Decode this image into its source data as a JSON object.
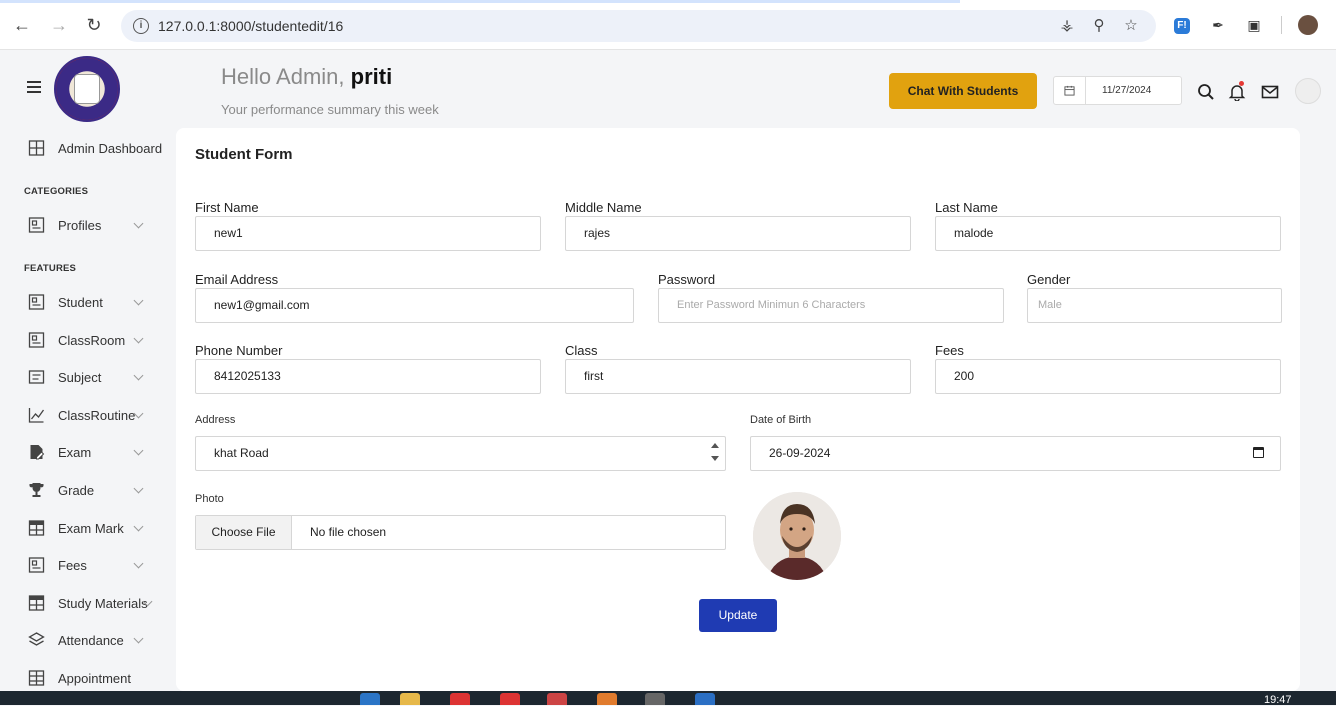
{
  "browser": {
    "url": "127.0.0.1:8000/studentedit/16",
    "ext_label": "F!"
  },
  "sidebar": {
    "dashboard": "Admin Dashboard",
    "categories_heading": "CATEGORIES",
    "profiles": "Profiles",
    "features_heading": "FEATURES",
    "items": [
      {
        "label": "Student",
        "icon": "grid-icon"
      },
      {
        "label": "ClassRoom",
        "icon": "grid-icon"
      },
      {
        "label": "Subject",
        "icon": "list-icon"
      },
      {
        "label": "ClassRoutine",
        "icon": "chart-line-icon"
      },
      {
        "label": "Exam",
        "icon": "file-edit-icon"
      },
      {
        "label": "Grade",
        "icon": "trophy-icon"
      },
      {
        "label": "Exam Mark",
        "icon": "table-icon"
      },
      {
        "label": "Fees",
        "icon": "grid-icon"
      },
      {
        "label": "Study Materials",
        "icon": "table-icon"
      },
      {
        "label": "Attendance",
        "icon": "layers-icon"
      },
      {
        "label": "Appointment",
        "icon": "table-icon"
      }
    ]
  },
  "header": {
    "greeting": "Hello Admin,",
    "name": "priti",
    "subtitle": "Your performance summary this week",
    "chat_button": "Chat With Students",
    "date": "11/27/2024"
  },
  "form": {
    "title": "Student Form",
    "first_name_label": "First Name",
    "first_name": "new1",
    "middle_name_label": "Middle Name",
    "middle_name": "rajes",
    "last_name_label": "Last Name",
    "last_name": "malode",
    "email_label": "Email Address",
    "email": "new1@gmail.com",
    "password_label": "Password",
    "password_placeholder": "Enter Password Minimun 6 Characters",
    "gender_label": "Gender",
    "gender_placeholder": "Male",
    "phone_label": "Phone Number",
    "phone": "8412025133",
    "class_label": "Class",
    "class": "first",
    "fees_label": "Fees",
    "fees": "200",
    "address_label": "Address",
    "address": "khat Road",
    "dob_label": "Date of Birth",
    "dob": "26-09-2024",
    "photo_label": "Photo",
    "choose_file": "Choose File",
    "no_file": "No file chosen",
    "update_button": "Update"
  },
  "taskbar": {
    "time": "19:47"
  },
  "colors": {
    "accent_yellow": "#e1a20f",
    "primary_blue": "#1f3bb3"
  }
}
